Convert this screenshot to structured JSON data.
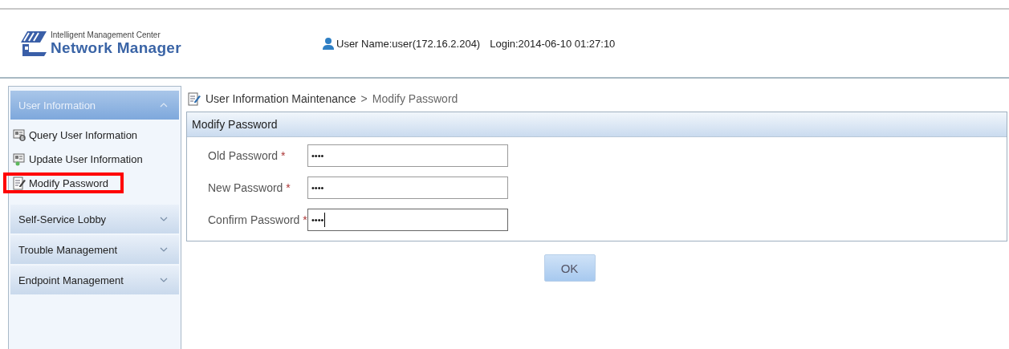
{
  "header": {
    "product_subtitle": "Intelligent Management Center",
    "product_title": "Network Manager",
    "user_info": "User Name:user(172.16.2.204)",
    "login_info": "Login:2014-06-10 01:27:10"
  },
  "sidebar": {
    "sections": [
      {
        "label": "User Information",
        "expanded": true,
        "items": [
          {
            "label": "Query User Information",
            "kind": "query",
            "highlighted": false
          },
          {
            "label": "Update User Information",
            "kind": "update",
            "highlighted": false
          },
          {
            "label": "Modify Password",
            "kind": "edit",
            "highlighted": true
          }
        ]
      },
      {
        "label": "Self-Service Lobby",
        "expanded": false
      },
      {
        "label": "Trouble Management",
        "expanded": false
      },
      {
        "label": "Endpoint Management",
        "expanded": false
      }
    ]
  },
  "breadcrumb": {
    "parent": "User Information Maintenance",
    "separator": ">",
    "current": "Modify Password"
  },
  "form": {
    "title": "Modify Password",
    "fields": [
      {
        "label": "Old Password",
        "required": "*",
        "value": "••••",
        "focused": false
      },
      {
        "label": "New Password",
        "required": "*",
        "value": "••••",
        "focused": false
      },
      {
        "label": "Confirm Password",
        "required": "*",
        "value": "••••",
        "focused": true
      }
    ],
    "button": "OK"
  }
}
